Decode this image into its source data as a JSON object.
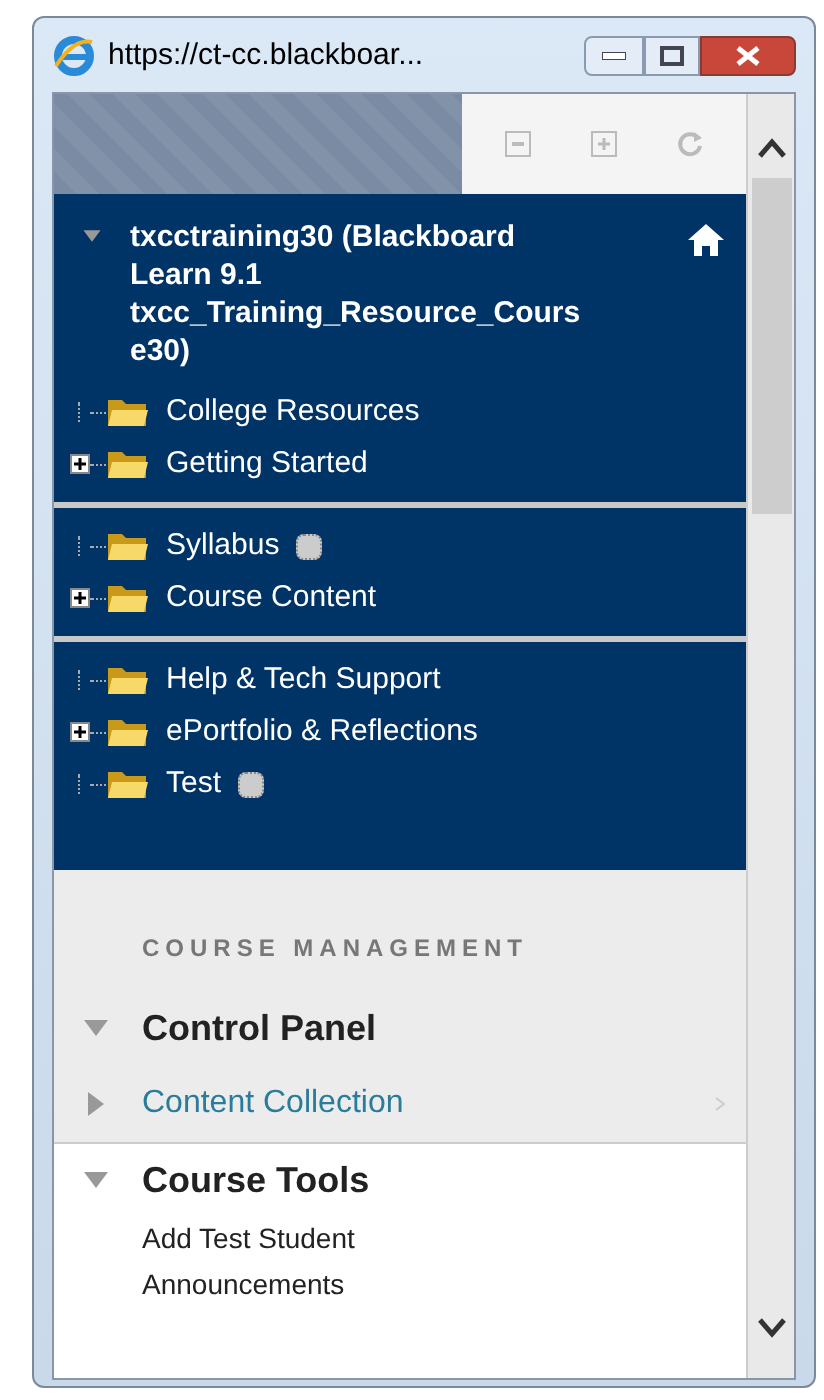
{
  "window": {
    "title": "https://ct-cc.blackboar..."
  },
  "course": {
    "title": "txcctraining30 (Blackboard Learn 9.1 txcc_Training_Resource_Course30)",
    "expanded": true
  },
  "menu_groups": [
    [
      {
        "label": "College Resources",
        "expandable": false,
        "badge": false
      },
      {
        "label": "Getting Started",
        "expandable": true,
        "badge": false
      }
    ],
    [
      {
        "label": "Syllabus",
        "expandable": false,
        "badge": true
      },
      {
        "label": "Course Content",
        "expandable": true,
        "badge": false
      }
    ],
    [
      {
        "label": "Help & Tech Support",
        "expandable": false,
        "badge": false
      },
      {
        "label": "ePortfolio & Reflections",
        "expandable": true,
        "badge": false
      },
      {
        "label": "Test",
        "expandable": false,
        "badge": true
      }
    ]
  ],
  "course_management": {
    "heading": "COURSE MANAGEMENT",
    "panels": [
      {
        "label": "Control Panel",
        "expanded": true
      },
      {
        "label": "Content Collection",
        "expanded": false
      }
    ],
    "course_tools": {
      "label": "Course Tools",
      "expanded": true,
      "items": [
        "Add Test Student",
        "Announcements"
      ]
    }
  }
}
